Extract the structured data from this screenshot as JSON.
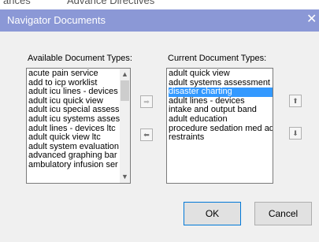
{
  "background": {
    "partial_text": [
      "ances",
      "Advance Directives"
    ]
  },
  "dialog": {
    "title": "Navigator Documents",
    "close_glyph": "✕"
  },
  "available": {
    "label": "Available Document Types:",
    "items": [
      "acute pain service",
      "add to icp worklist",
      "adult icu lines - devices",
      "adult icu quick view",
      "adult icu special assess",
      "adult icu systems asses",
      "adult lines - devices ltc",
      "adult quick view ltc",
      "adult system evaluation",
      "advanced graphing bar",
      "ambulatory infusion ser"
    ]
  },
  "current": {
    "label": "Current Document Types:",
    "items": [
      "adult quick view",
      "adult systems assessment",
      "disaster charting",
      "adult lines - devices",
      "intake and output band",
      "adult education",
      "procedure sedation med ad",
      "restraints"
    ],
    "selected": "disaster charting"
  },
  "icons": {
    "add_arrow": "➡",
    "remove_arrow": "⬅",
    "move_up": "⬆",
    "move_down": "⬇",
    "scroll_up": "▲",
    "scroll_down": "▼"
  },
  "buttons": {
    "ok": "OK",
    "cancel": "Cancel"
  },
  "colors": {
    "titlebar": "#8b98d6",
    "selection": "#3399ff",
    "dialog_bg": "#f0f0f0",
    "default_button_border": "#0078d7"
  }
}
